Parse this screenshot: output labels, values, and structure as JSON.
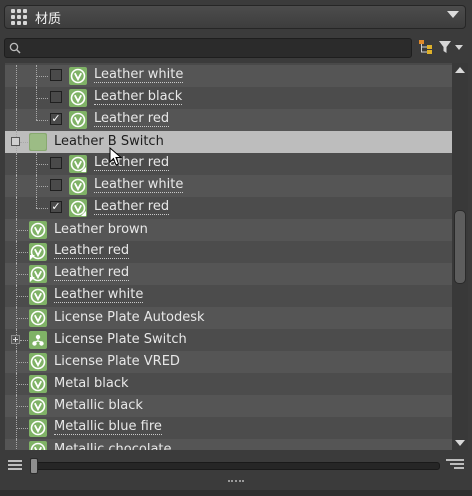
{
  "header": {
    "title": "材质",
    "menu_icon": "grid-menu-icon",
    "dropdown_icon": "chevron-down-icon"
  },
  "search": {
    "value": "",
    "placeholder": "",
    "search_icon": "magnifier-icon",
    "hierarchy_icon": "hierarchy-icon",
    "filter_icon": "filter-icon"
  },
  "tree": {
    "rows": [
      {
        "label": "Leather white",
        "checked": false
      },
      {
        "label": "Leather black",
        "checked": false
      },
      {
        "label": "Leather red",
        "checked": true
      },
      {
        "label": "Leather B Switch",
        "type": "switch",
        "selected": true
      },
      {
        "label": "Leather red",
        "checked": false
      },
      {
        "label": "Leather white",
        "checked": false
      },
      {
        "label": "Leather red",
        "checked": true
      },
      {
        "label": "Leather brown"
      },
      {
        "label": "Leather red"
      },
      {
        "label": "Leather red"
      },
      {
        "label": "Leather white"
      },
      {
        "label": "License Plate Autodesk"
      },
      {
        "label": "License Plate Switch",
        "type": "switch"
      },
      {
        "label": "License Plate VRED"
      },
      {
        "label": "Metal black"
      },
      {
        "label": "Metallic black"
      },
      {
        "label": "Metallic blue fire"
      },
      {
        "label": "Metallic chocolate"
      }
    ]
  },
  "colors": {
    "panel_bg": "#3b3b3b",
    "row_light": "#555555",
    "row_dark": "#4c4c4c",
    "row_selected": "#bdbdbd",
    "material_icon": "#7fb266"
  }
}
